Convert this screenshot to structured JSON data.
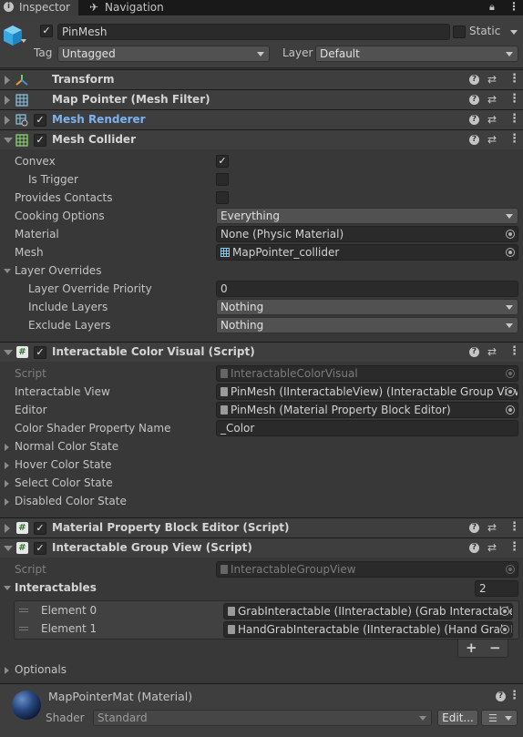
{
  "tabs": [
    {
      "label": "Inspector",
      "icon": "info-icon",
      "active": true
    },
    {
      "label": "Navigation",
      "icon": "navigation-icon",
      "active": false
    }
  ],
  "object": {
    "name": "PinMesh",
    "active": true,
    "static_label": "Static",
    "tag_label": "Tag",
    "tag_value": "Untagged",
    "layer_label": "Layer",
    "layer_value": "Default"
  },
  "components": {
    "transform": {
      "title": "Transform"
    },
    "mesh_filter": {
      "title": "Map Pointer (Mesh Filter)"
    },
    "mesh_renderer": {
      "title": "Mesh Renderer",
      "enabled": true
    },
    "mesh_collider": {
      "title": "Mesh Collider",
      "enabled": true,
      "convex_label": "Convex",
      "convex": true,
      "is_trigger_label": "Is Trigger",
      "is_trigger": false,
      "provides_contacts_label": "Provides Contacts",
      "provides_contacts": false,
      "cooking_options_label": "Cooking Options",
      "cooking_options": "Everything",
      "material_label": "Material",
      "material": "None (Physic Material)",
      "mesh_label": "Mesh",
      "mesh": "MapPointer_collider",
      "layer_overrides_label": "Layer Overrides",
      "layer_override_priority_label": "Layer Override Priority",
      "layer_override_priority": "0",
      "include_layers_label": "Include Layers",
      "include_layers": "Nothing",
      "exclude_layers_label": "Exclude Layers",
      "exclude_layers": "Nothing"
    },
    "color_visual": {
      "title": "Interactable Color Visual (Script)",
      "enabled": true,
      "script_label": "Script",
      "script": "InteractableColorVisual",
      "interactable_view_label": "Interactable View",
      "interactable_view": "PinMesh (IInteractableView) (Interactable Group View)",
      "editor_label": "Editor",
      "editor": "PinMesh (Material Property Block Editor)",
      "color_shader_label": "Color Shader Property Name",
      "color_shader": "_Color",
      "states": [
        "Normal Color State",
        "Hover Color State",
        "Select Color State",
        "Disabled Color State"
      ]
    },
    "mpb_editor": {
      "title": "Material Property Block Editor (Script)",
      "enabled": true
    },
    "group_view": {
      "title": "Interactable Group View (Script)",
      "enabled": true,
      "script_label": "Script",
      "script": "InteractableGroupView",
      "interactables_label": "Interactables",
      "interactables_count": "2",
      "elements": [
        {
          "label": "Element 0",
          "value": "GrabInteractable (IInteractable) (Grab Interactable)"
        },
        {
          "label": "Element 1",
          "value": "HandGrabInteractable (IInteractable) (Hand Grab Interactable)"
        }
      ],
      "add": "+",
      "remove": "−",
      "optionals_label": "Optionals"
    },
    "material": {
      "title": "MapPointerMat (Material)",
      "shader_label": "Shader",
      "shader": "Standard",
      "edit_label": "Edit..."
    }
  },
  "colors": {
    "accent_check": "#e6e6e6",
    "renderer_title": "#7cb2f0",
    "script_icon": "#3c8c3c"
  }
}
